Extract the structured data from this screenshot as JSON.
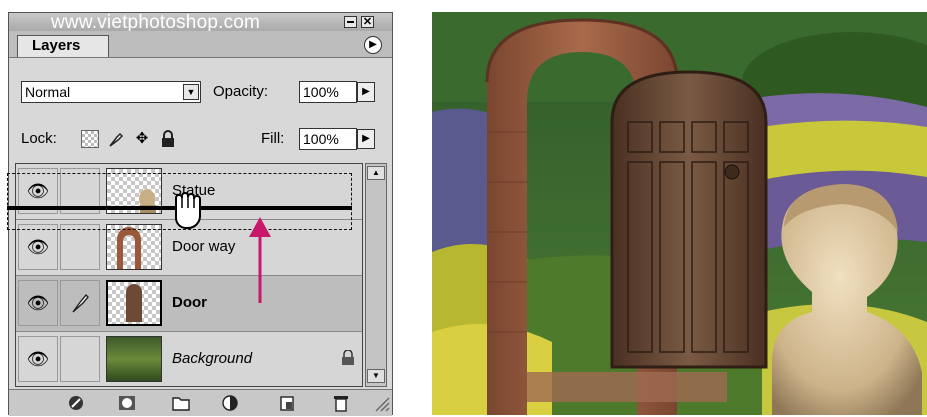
{
  "watermark": "www.vietphotoshop.com",
  "panel": {
    "tab_label": "Layers",
    "blend_mode": "Normal",
    "opacity_label": "Opacity:",
    "opacity_value": "100%",
    "lock_label": "Lock:",
    "fill_label": "Fill:",
    "fill_value": "100%"
  },
  "layers": [
    {
      "name": "Statue",
      "style": "normal",
      "selected": false
    },
    {
      "name": "Door way",
      "style": "normal",
      "selected": false
    },
    {
      "name": "Door",
      "style": "bold",
      "selected": true
    },
    {
      "name": "Background",
      "style": "italic",
      "selected": false,
      "locked": true
    }
  ],
  "colors": {
    "drag_arrow": "#c8186a",
    "selected_row": "#bdbdbd"
  },
  "icons": [
    "eye-icon",
    "brush-icon",
    "lock-transparent-icon",
    "lock-paint-icon",
    "lock-move-icon",
    "lock-all-icon",
    "layer-style-icon",
    "mask-icon",
    "new-set-icon",
    "adjustment-icon",
    "new-layer-icon",
    "trash-icon",
    "hand-cursor-icon"
  ]
}
